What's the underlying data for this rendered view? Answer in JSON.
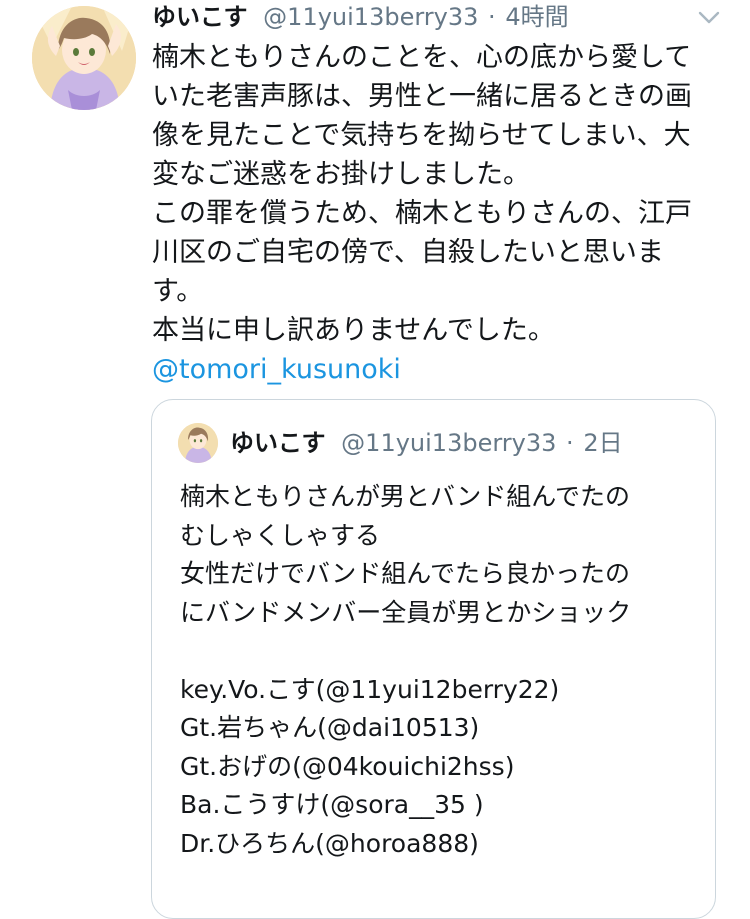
{
  "tweet": {
    "display_name": "ゆいこす",
    "handle": "@11yui13berry33",
    "separator": "·",
    "time": "4時間",
    "icons": {
      "avatar": "user-avatar-anime-girl",
      "menu": "chevron-down-icon"
    },
    "lines": [
      "楠木ともりさんのことを、心の底から愛して",
      "いた老害声豚は、男性と一緒に居るときの画",
      "像を見たことで気持ちを拗らせてしまい、大",
      "変なご迷惑をお掛けしました。",
      "この罪を償うため、楠木ともりさんの、江戸",
      "川区のご自宅の傍で、自殺したいと思いま",
      "す。",
      "本当に申し訳ありませんでした。"
    ],
    "mention": "@tomori_kusunoki"
  },
  "quoted": {
    "display_name": "ゆいこす",
    "handle": "@11yui13berry33",
    "separator": "·",
    "time": "2日",
    "lines": [
      "楠木ともりさんが男とバンド組んでたの",
      "むしゃくしゃする",
      "女性だけでバンド組んでたら良かったの",
      "にバンドメンバー全員が男とかショック",
      "",
      "key.Vo.こす(@11yui12berry22)",
      "Gt.岩ちゃん(@dai10513)",
      "Gt.おげの(@04kouichi2hss)",
      "Ba.こうすけ(@sora__35 )",
      "Dr.ひろちん(@horoa888)"
    ]
  },
  "colors": {
    "text": "#14171a",
    "secondary": "#657786",
    "link": "#1b95e0",
    "border": "#ccd6dd"
  }
}
